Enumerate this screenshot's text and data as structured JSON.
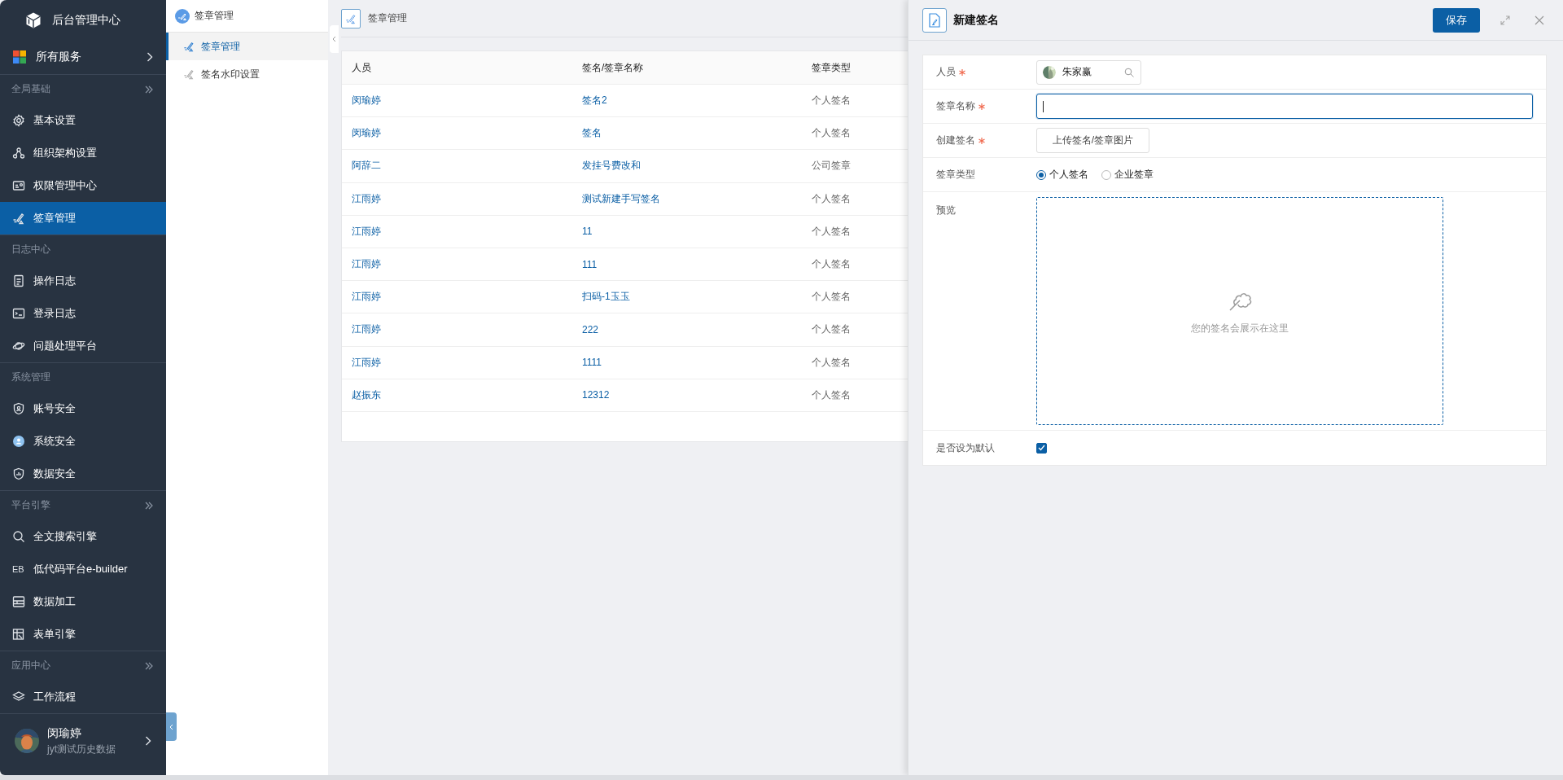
{
  "sidebar": {
    "title": "后台管理中心",
    "all_services": "所有服务",
    "groups": [
      {
        "label": "全局基础",
        "collapsible": true,
        "items": [
          {
            "label": "基本设置",
            "selected": false
          },
          {
            "label": "组织架构设置",
            "selected": false
          },
          {
            "label": "权限管理中心",
            "selected": false
          },
          {
            "label": "签章管理",
            "selected": true
          }
        ]
      },
      {
        "label": "日志中心",
        "collapsible": false,
        "items": [
          {
            "label": "操作日志",
            "selected": false
          },
          {
            "label": "登录日志",
            "selected": false
          },
          {
            "label": "问题处理平台",
            "selected": false
          }
        ]
      },
      {
        "label": "系统管理",
        "collapsible": false,
        "items": [
          {
            "label": "账号安全",
            "selected": false
          },
          {
            "label": "系统安全",
            "selected": false
          },
          {
            "label": "数据安全",
            "selected": false
          }
        ]
      },
      {
        "label": "平台引擎",
        "collapsible": true,
        "items": [
          {
            "label": "全文搜索引擎",
            "selected": false
          },
          {
            "label": "低代码平台e-builder",
            "badge": "EB",
            "selected": false
          },
          {
            "label": "数据加工",
            "selected": false
          },
          {
            "label": "表单引擎",
            "selected": false
          }
        ]
      },
      {
        "label": "应用中心",
        "collapsible": true,
        "items": [
          {
            "label": "工作流程",
            "selected": false
          }
        ]
      }
    ],
    "user": {
      "name": "闵瑜婷",
      "org": "jyt测试历史数据"
    }
  },
  "nav_panel": {
    "title": "签章管理",
    "items": [
      {
        "label": "签章管理",
        "selected": true
      },
      {
        "label": "签名水印设置",
        "selected": false
      }
    ]
  },
  "page": {
    "title": "签章管理",
    "table": {
      "columns": [
        "人员",
        "签名/签章名称",
        "签章类型"
      ],
      "rows": [
        [
          "闵瑜婷",
          "签名2",
          "个人签名"
        ],
        [
          "闵瑜婷",
          "签名",
          "个人签名"
        ],
        [
          "阿辞二",
          "发挂号费改和",
          "公司签章"
        ],
        [
          "江雨婷",
          "测试新建手写签名",
          "个人签名"
        ],
        [
          "江雨婷",
          "11",
          "个人签名"
        ],
        [
          "江雨婷",
          "111",
          "个人签名"
        ],
        [
          "江雨婷",
          "扫码-1玉玉",
          "个人签名"
        ],
        [
          "江雨婷",
          "222",
          "个人签名"
        ],
        [
          "江雨婷",
          "1111",
          "个人签名"
        ],
        [
          "赵振东",
          "12312",
          "个人签名"
        ]
      ]
    }
  },
  "drawer": {
    "title": "新建签名",
    "save": "保存",
    "fields": [
      {
        "kind": "person",
        "label": "人员",
        "required": true,
        "value": "朱家赢"
      },
      {
        "kind": "text",
        "label": "签章名称",
        "required": true,
        "focused": true
      },
      {
        "kind": "upload",
        "label": "创建签名",
        "required": true,
        "button": "上传签名/签章图片"
      },
      {
        "kind": "radio",
        "label": "签章类型",
        "required": false,
        "options": [
          {
            "label": "个人签名",
            "selected": true
          },
          {
            "label": "企业签章",
            "selected": false
          }
        ]
      },
      {
        "kind": "preview",
        "label": "预览",
        "required": false,
        "hint": "您的签名会展示在这里"
      },
      {
        "kind": "checkbox",
        "label": "是否设为默认",
        "required": false,
        "checked": true
      }
    ]
  }
}
